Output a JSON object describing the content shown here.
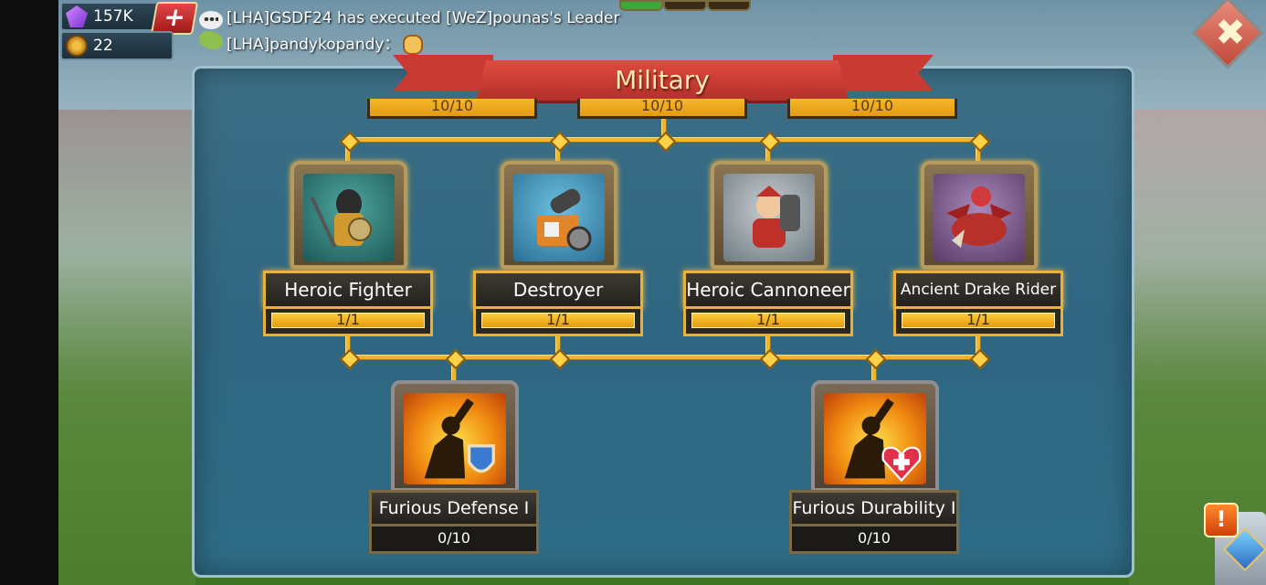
{
  "hud": {
    "gems": "157K",
    "coins": "22",
    "add_label": "+"
  },
  "chat": {
    "line1": "[LHA]GSDF24 has executed [WeZ]pounas's Leader",
    "line2": "[LHA]pandykopandy："
  },
  "panel": {
    "title": "Military",
    "close_label": "✖"
  },
  "top_row": [
    {
      "progress": "10/10"
    },
    {
      "progress": "10/10"
    },
    {
      "progress": "10/10"
    }
  ],
  "troops": [
    {
      "name": "Heroic Fighter",
      "progress": "1/1"
    },
    {
      "name": "Destroyer",
      "progress": "1/1"
    },
    {
      "name": "Heroic Cannoneer",
      "progress": "1/1"
    },
    {
      "name": "Ancient Drake Rider",
      "progress": "1/1"
    }
  ],
  "skills": [
    {
      "name": "Furious Defense I",
      "progress": "0/10"
    },
    {
      "name": "Furious Durability I",
      "progress": "0/10"
    }
  ],
  "alert_label": "!",
  "colors": {
    "gold": "#f0b52a",
    "banner": "#c93a33",
    "panel": "#2f6681"
  }
}
